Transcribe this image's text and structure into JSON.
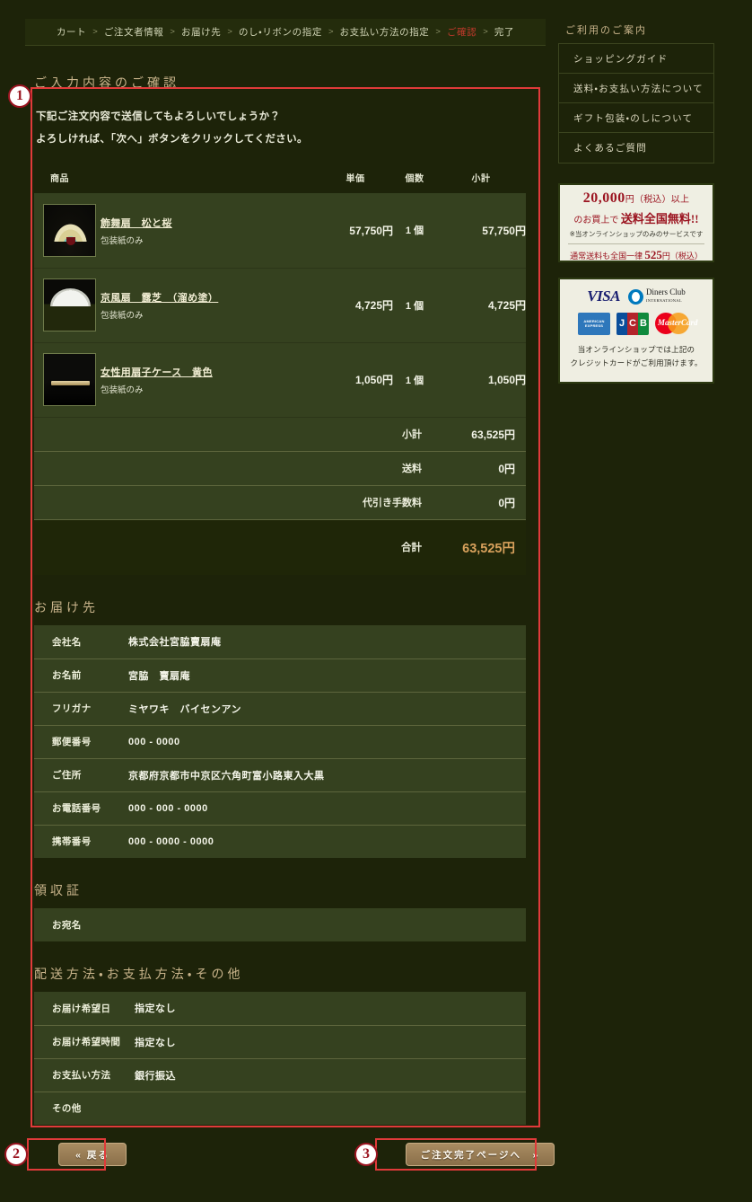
{
  "breadcrumb": {
    "separator": ">",
    "items": [
      {
        "label": "カート",
        "current": false
      },
      {
        "label": "ご注文者情報",
        "current": false
      },
      {
        "label": "お届け先",
        "current": false
      },
      {
        "label": "のし・リボンの指定",
        "current": false
      },
      {
        "label": "お支払い方法の指定",
        "current": false
      },
      {
        "label": "ご確認",
        "current": true
      },
      {
        "label": "完了",
        "current": false
      }
    ]
  },
  "main": {
    "section_title": "ご入力内容のご確認",
    "intro_line1": "下記ご注文内容で送信してもよろしいでしょうか？",
    "intro_line2": "よろしければ、「次へ」ボタンをクリックしてください。",
    "cart": {
      "headers": {
        "item": "商品",
        "unit_price": "単価",
        "quantity": "個数",
        "subtotal": "小計"
      },
      "rows": [
        {
          "name": "飾舞扇　松と桜",
          "note": "包装紙のみ",
          "thumb": "folding-fan-pine-sakura",
          "unit_price": "57,750円",
          "quantity": "1 個",
          "subtotal": "57,750円"
        },
        {
          "name": "京風扇　露芝　（溜め塗）",
          "note": "包装紙のみ",
          "thumb": "folding-fan-tsuyushiba",
          "unit_price": "4,725円",
          "quantity": "1 個",
          "subtotal": "4,725円"
        },
        {
          "name": "女性用扇子ケース　黄色",
          "note": "包装紙のみ",
          "thumb": "fan-case-yellow",
          "unit_price": "1,050円",
          "quantity": "1 個",
          "subtotal": "1,050円"
        }
      ],
      "summary": [
        {
          "label": "小計",
          "value": "63,525円"
        },
        {
          "label": "送料",
          "value": "0円"
        },
        {
          "label": "代引き手数料",
          "value": "0円"
        }
      ],
      "total": {
        "label": "合計",
        "value": "63,525円"
      }
    },
    "shipping": {
      "title": "お届け先",
      "rows": [
        {
          "key": "会社名",
          "value": "株式会社宮脇賣扇庵"
        },
        {
          "key": "お名前",
          "value": "宮脇　賣扇庵"
        },
        {
          "key": "フリガナ",
          "value": "ミヤワキ　バイセンアン"
        },
        {
          "key": "郵便番号",
          "value": "000 - 0000"
        },
        {
          "key": "ご住所",
          "value": "京都府京都市中京区六角町富小路東入大黒"
        },
        {
          "key": "お電話番号",
          "value": "000 - 000 - 0000"
        },
        {
          "key": "携帯番号",
          "value": "000 - 0000 - 0000"
        }
      ]
    },
    "receipt": {
      "title": "領収証",
      "rows": [
        {
          "key": "お宛名",
          "value": ""
        }
      ]
    },
    "delivery": {
      "title": "配送方法・お支払方法・その他",
      "rows": [
        {
          "key": "お届け希望日",
          "value": "指定なし"
        },
        {
          "key": "お届け希望時間",
          "value": "指定なし"
        },
        {
          "key": "お支払い方法",
          "value": "銀行振込"
        },
        {
          "key": "その他",
          "value": ""
        }
      ]
    },
    "buttons": {
      "back": "« 戻る",
      "next": "ご注文完了ページへ　»"
    }
  },
  "annotations": [
    {
      "id": "1",
      "number": "1"
    },
    {
      "id": "2",
      "number": "2"
    },
    {
      "id": "3",
      "number": "3"
    }
  ],
  "sidebar": {
    "title": "ご利用のご案内",
    "items": [
      {
        "label": "ショッピングガイド"
      },
      {
        "label": "送料・お支払い方法について"
      },
      {
        "label": "ギフト包装・のしについて"
      },
      {
        "label": "よくあるご質問"
      }
    ],
    "promo": {
      "amount": "20,000",
      "line1_suffix": "円（税込）以上",
      "line2_prefix": "のお買上で ",
      "line2_strong": "送料全国無料!!",
      "note": "※当オンラインショップのみのサービスです",
      "line4_prefix": "通常送料も全国一律 ",
      "line4_amount": "525",
      "line4_suffix": "円（税込）"
    },
    "cards": {
      "logos": [
        "visa",
        "diners-club",
        "american-express",
        "jcb",
        "mastercard"
      ],
      "visa_label": "VISA",
      "diners_label": "Diners Club",
      "diners_sub": "INTERNATIONAL",
      "amex_label": "AMERICAN EXPRESS",
      "jcb_letters": [
        "J",
        "C",
        "B"
      ],
      "mc_label": "MasterCard",
      "caption_line1": "当オンラインショップでは上記の",
      "caption_line2": "クレジットカードがご利用頂けます。"
    }
  },
  "colors": {
    "page_bg": "#1d2309",
    "row_bg": "#35411f",
    "accent_gold": "#c9b48b",
    "total_amount": "#d8a15c",
    "annotation_red": "#e03a3a",
    "promo_red": "#9b1420",
    "current_crumb": "#c0392b"
  }
}
